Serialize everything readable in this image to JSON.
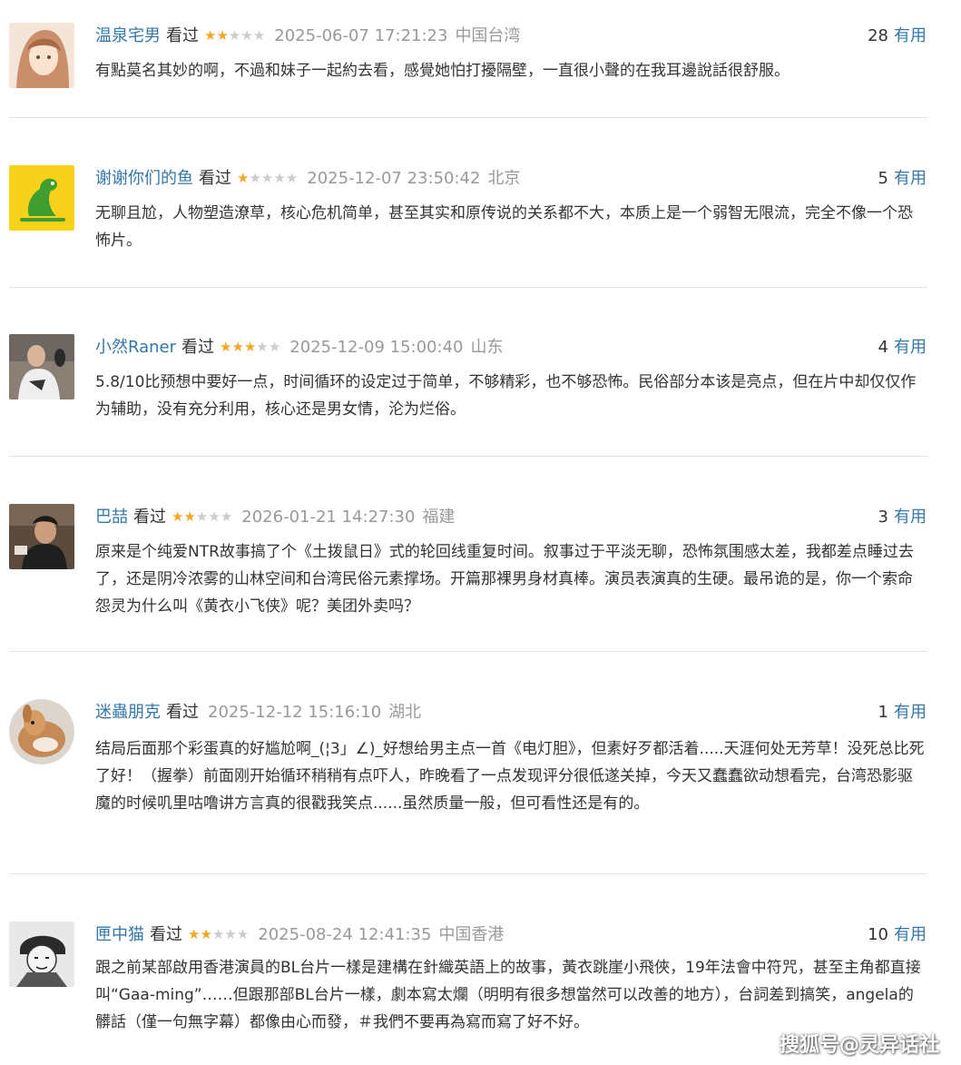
{
  "comments": [
    {
      "username": "温泉宅男",
      "watched": "看过",
      "rating": 2,
      "time": "2025-06-07 17:21:23",
      "location": "中国台湾",
      "votes": "28",
      "useful": "有用",
      "text": "有點莫名其妙的啊，不過和妹子一起約去看，感覺她怕打擾隔壁，一直很小聲的在我耳邊說話很舒服。"
    },
    {
      "username": "谢谢你们的鱼",
      "watched": "看过",
      "rating": 1,
      "time": "2025-12-07 23:50:42",
      "location": "北京",
      "votes": "5",
      "useful": "有用",
      "text": "无聊且尬，人物塑造潦草，核心危机简单，甚至其实和原传说的关系都不大，本质上是一个弱智无限流，完全不像一个恐怖片。"
    },
    {
      "username": "小然Raner",
      "watched": "看过",
      "rating": 3,
      "time": "2025-12-09 15:00:40",
      "location": "山东",
      "votes": "4",
      "useful": "有用",
      "text": "5.8/10比预想中要好一点，时间循环的设定过于简单，不够精彩，也不够恐怖。民俗部分本该是亮点，但在片中却仅仅作为辅助，没有充分利用，核心还是男女情，沦为烂俗。"
    },
    {
      "username": "巴喆",
      "watched": "看过",
      "rating": 2,
      "time": "2026-01-21 14:27:30",
      "location": "福建",
      "votes": "3",
      "useful": "有用",
      "text": "原来是个纯爱NTR故事搞了个《土拨鼠日》式的轮回线重复时间。叙事过于平淡无聊，恐怖氛围感太差，我都差点睡过去了，还是阴冷浓雾的山林空间和台湾民俗元素撑场。开篇那裸男身材真棒。演员表演真的生硬。最吊诡的是，你一个索命怨灵为什么叫《黄衣小飞侠》呢？美团外卖吗？"
    },
    {
      "username": "迷蟲朋克",
      "watched": "看过",
      "rating": 0,
      "time": "2025-12-12 15:16:10",
      "location": "湖北",
      "votes": "1",
      "useful": "有用",
      "text": "结局后面那个彩蛋真的好尴尬啊_(¦3」∠)_好想给男主点一首《电灯胆》，但素好歹都活着.....天涯何处无芳草！没死总比死了好！（握拳）前面刚开始循环稍稍有点吓人，昨晚看了一点发现评分很低遂关掉，今天又蠢蠢欲动想看完，台湾恐影驱魔的时候叽里咕噜讲方言真的很戳我笑点......虽然质量一般，但可看性还是有的。"
    },
    {
      "username": "匣中猫",
      "watched": "看过",
      "rating": 2,
      "time": "2025-08-24 12:41:35",
      "location": "中国香港",
      "votes": "10",
      "useful": "有用",
      "text": "跟之前某部啟用香港演員的BL台片一樣是建構在針織英語上的故事，黃衣跳崖小飛俠，19年法會中符咒，甚至主角都直接叫“Gaa-ming”……但跟那部BL台片一樣，劇本寫太爛（明明有很多想當然可以改善的地方），台詞差到搞笑，angela的髒話（僅一句無字幕）都像由心而發，＃我們不要再為寫而寫了好不好。"
    }
  ],
  "watermark": "搜狐号@灵异话社"
}
